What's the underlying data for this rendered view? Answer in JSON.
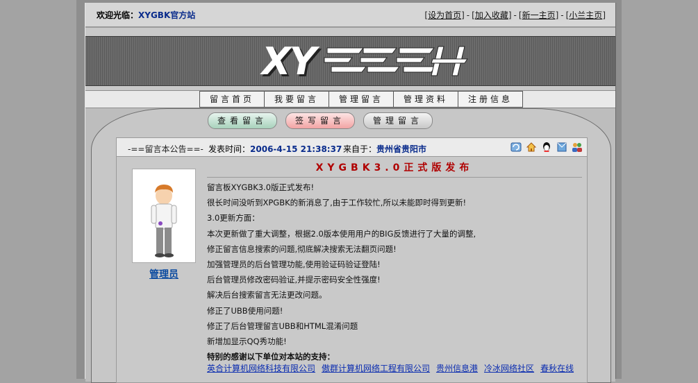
{
  "topbar": {
    "welcome_prefix": "欢迎光临：",
    "site_name": "XYGBK官方站",
    "links": [
      "设为首页",
      "加入收藏",
      "新一主页",
      "小兰主页"
    ]
  },
  "logo": {
    "text": "XY"
  },
  "nav": {
    "items": [
      "留言首页",
      "我要留言",
      "管理留言",
      "管理资料",
      "注册信息"
    ]
  },
  "actions": {
    "view": "查看留言",
    "write": "签写留言",
    "manage": "管理留言"
  },
  "notice": {
    "panel_title": "-==留言本公告==-",
    "time_label": "发表时间：",
    "time_value": "2006-4-15 21:38:37",
    "from_label": "来自于：",
    "from_value": "贵州省贵阳市",
    "author": "管理员",
    "title": "XYGBK3.0正式版发布",
    "lines": [
      "留言板XYGBK3.0版正式发布!",
      "很长时间没听到XPGBK的新消息了,由于工作较忙,所以未能即时得到更新!",
      "3.0更新方面：",
      "本次更新做了重大调整，根据2.0版本使用用户的BIG反馈进行了大量的调整,",
      "修正留言信息搜索的问题,彻底解决搜索无法翻页问题!",
      "加强管理员的后台管理功能,使用验证码验证登陆!",
      "后台管理员修改密码验证,并提示密码安全性强度!",
      "解决后台搜索留言无法更改问题。",
      "修正了UBB使用问题!",
      "修正了后台管理留言UBB和HTML混淆问题",
      "新增加显示QQ秀功能!"
    ],
    "thanks_heading": "特别的感谢以下单位对本站的支持：",
    "thanks_links": [
      "英合计算机网络科技有限公司",
      "傲群计算机网络工程有限公司",
      "贵州信息港",
      "冷冰网络社区",
      "春秋在线"
    ]
  },
  "icons": [
    "refresh-icon",
    "home-icon",
    "qq-icon",
    "email-icon",
    "users-icon"
  ],
  "colors": {
    "link": "#0a2cb0",
    "title_red": "#b00000",
    "accent_blue": "#0a2c8c"
  }
}
